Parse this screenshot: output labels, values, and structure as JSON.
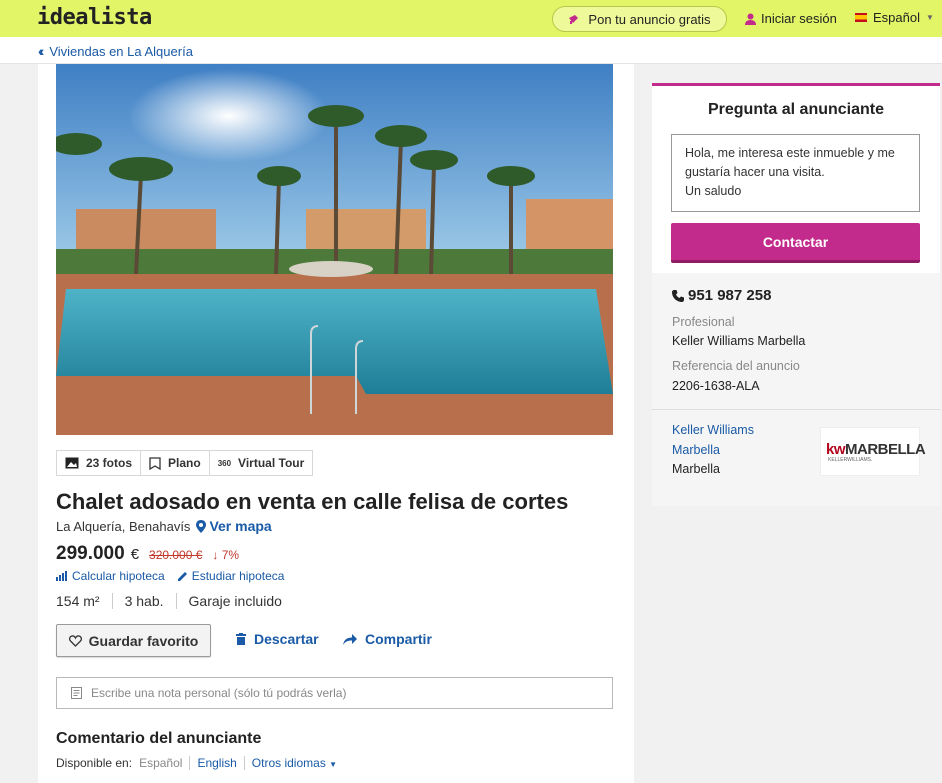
{
  "header": {
    "logo": "idealista",
    "post_ad_label": "Pon tu anuncio gratis",
    "login_label": "Iniciar sesión",
    "language_label": "Español"
  },
  "breadcrumb": {
    "label": "Viviendas en La Alquería"
  },
  "media_tabs": [
    {
      "label": "23 fotos",
      "icon": "photo-icon"
    },
    {
      "label": "Plano",
      "icon": "floorplan-icon"
    },
    {
      "label": "Virtual Tour",
      "icon": "360-icon",
      "badge": "360"
    }
  ],
  "listing": {
    "title": "Chalet adosado en venta en calle felisa de cortes",
    "location": "La Alquería, Benahavís",
    "map_link": "Ver mapa",
    "price": "299.000",
    "currency": "€",
    "old_price": "320.000 €",
    "price_drop": "↓ 7%",
    "mortgage_calc": "Calcular hipoteca",
    "mortgage_study": "Estudiar hipoteca",
    "features": [
      "154 m²",
      "3 hab.",
      "Garaje incluido"
    ]
  },
  "actions": {
    "favorite": "Guardar favorito",
    "discard": "Descartar",
    "share": "Compartir",
    "note_placeholder": "Escribe una nota personal (sólo tú podrás verla)"
  },
  "comments": {
    "title": "Comentario del anunciante",
    "available_in": "Disponible en:",
    "current_language": "Español",
    "english": "English",
    "other_languages": "Otros idiomas"
  },
  "sidebar": {
    "title": "Pregunta al anunciante",
    "message_lines": [
      "Hola, me interesa este inmueble y me",
      "gustaría hacer una visita.",
      "Un saludo"
    ],
    "contact_button": "Contactar",
    "phone": "951 987 258",
    "advertiser_type_label": "Profesional",
    "advertiser_name": "Keller Williams Marbella",
    "reference_label": "Referencia del anuncio",
    "reference_value": "2206-1638-ALA",
    "agency_lines": [
      "Keller Williams",
      "Marbella"
    ],
    "agency_city": "Marbella",
    "agency_logo_kw": "kw",
    "agency_logo_text": "MARBELLA",
    "agency_logo_sub": "KELLERWILLIAMS."
  },
  "colors": {
    "header_bg": "#e1f567",
    "accent": "#c22b8b",
    "link": "#1a5aa6",
    "price_drop": "#c0392b"
  }
}
